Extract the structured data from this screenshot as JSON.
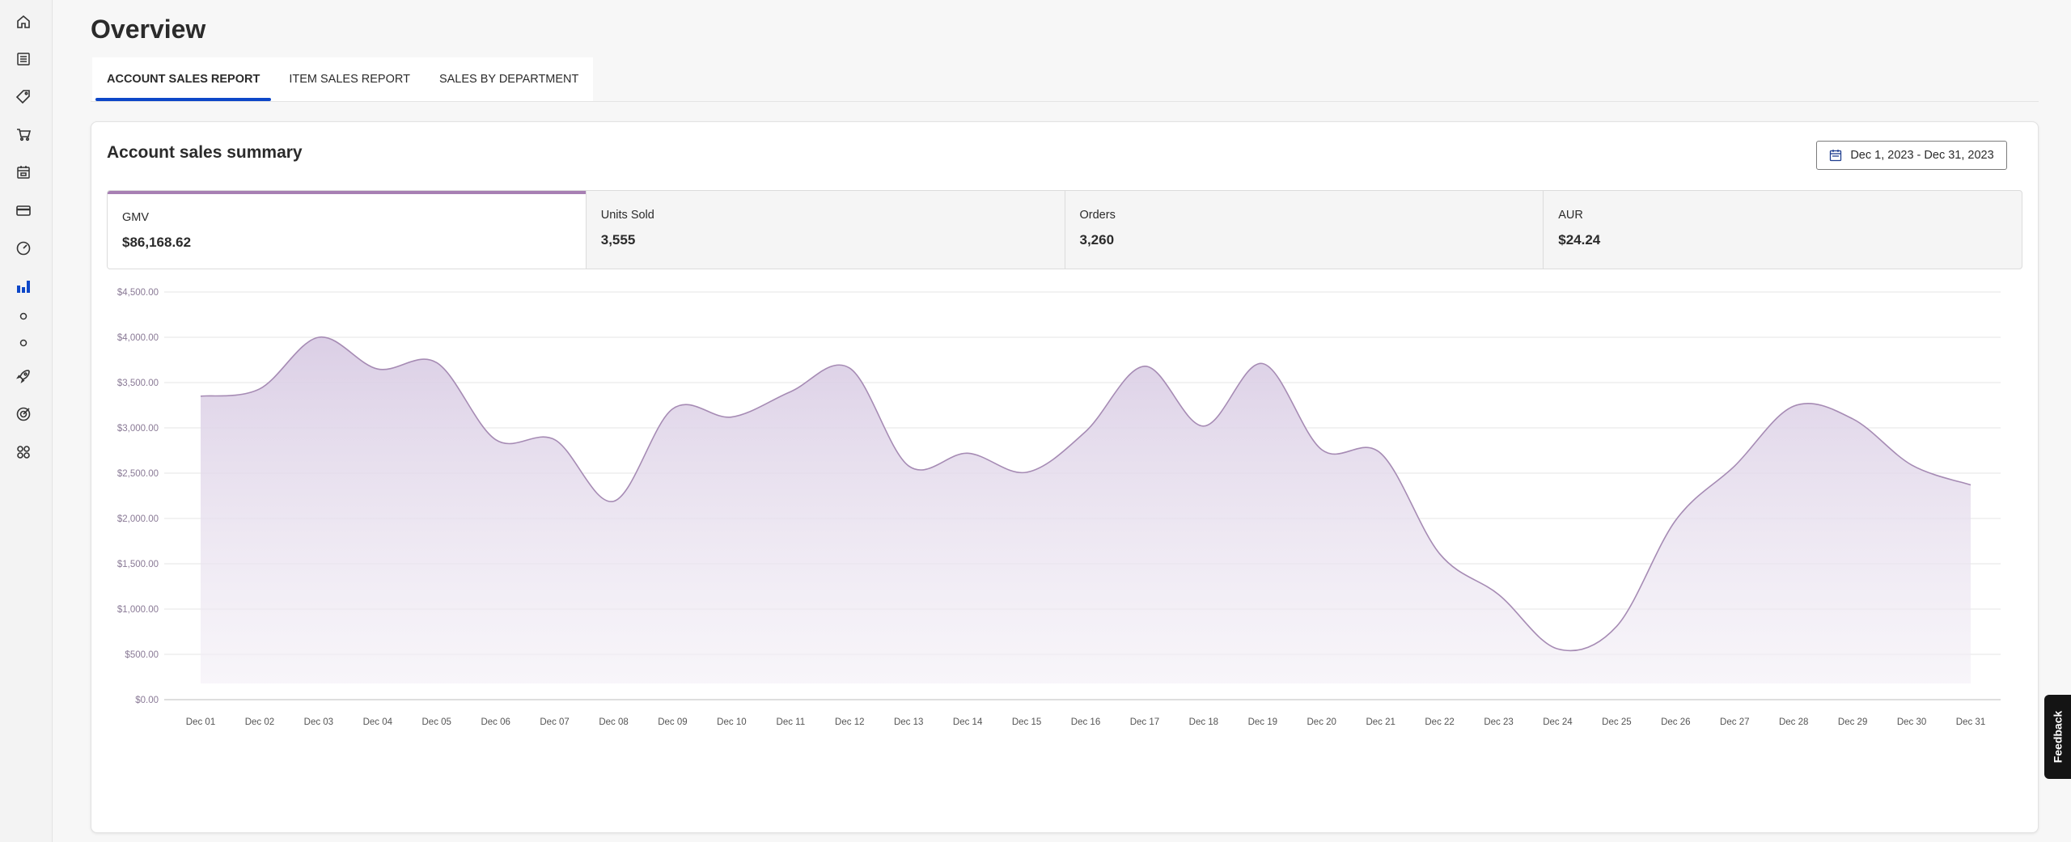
{
  "page": {
    "title": "Overview"
  },
  "sidebar": {
    "items": [
      {
        "name": "home-icon",
        "active": false
      },
      {
        "name": "list-icon",
        "active": false
      },
      {
        "name": "tag-icon",
        "active": false
      },
      {
        "name": "cart-icon",
        "active": false
      },
      {
        "name": "calendar-box-icon",
        "active": false
      },
      {
        "name": "card-icon",
        "active": false
      },
      {
        "name": "speedometer-icon",
        "active": false
      },
      {
        "name": "bar-chart-icon",
        "active": true
      },
      {
        "name": "small-circle-icon",
        "active": false
      },
      {
        "name": "small-circle-icon",
        "active": false
      },
      {
        "name": "rocket-icon",
        "active": false
      },
      {
        "name": "target-icon",
        "active": false
      },
      {
        "name": "grid-icon",
        "active": false
      }
    ]
  },
  "tabs": [
    {
      "label": "ACCOUNT SALES REPORT",
      "active": true
    },
    {
      "label": "ITEM SALES REPORT",
      "active": false
    },
    {
      "label": "SALES BY DEPARTMENT",
      "active": false
    }
  ],
  "card": {
    "title": "Account sales summary",
    "date_range": "Dec 1, 2023 - Dec 31, 2023"
  },
  "metrics": [
    {
      "label": "GMV",
      "value": "$86,168.62",
      "active": true
    },
    {
      "label": "Units Sold",
      "value": "3,555",
      "active": false
    },
    {
      "label": "Orders",
      "value": "3,260",
      "active": false
    },
    {
      "label": "AUR",
      "value": "$24.24",
      "active": false
    }
  ],
  "feedback": {
    "label": "Feedback"
  },
  "colors": {
    "accent": "#0d47c8",
    "series_line": "#a68bb4",
    "series_fill": "#dcd0e6",
    "metric_highlight": "#a77fb3"
  },
  "chart_data": {
    "type": "area",
    "title": "",
    "xlabel": "",
    "ylabel": "",
    "ylim": [
      0,
      4500
    ],
    "grid": true,
    "yticks": [
      "$0.00",
      "$500.00",
      "$1,000.00",
      "$1,500.00",
      "$2,000.00",
      "$2,500.00",
      "$3,000.00",
      "$3,500.00",
      "$4,000.00",
      "$4,500.00"
    ],
    "categories": [
      "Dec 01",
      "Dec 02",
      "Dec 03",
      "Dec 04",
      "Dec 05",
      "Dec 06",
      "Dec 07",
      "Dec 08",
      "Dec 09",
      "Dec 10",
      "Dec 11",
      "Dec 12",
      "Dec 13",
      "Dec 14",
      "Dec 15",
      "Dec 16",
      "Dec 17",
      "Dec 18",
      "Dec 19",
      "Dec 20",
      "Dec 21",
      "Dec 22",
      "Dec 23",
      "Dec 24",
      "Dec 25",
      "Dec 26",
      "Dec 27",
      "Dec 28",
      "Dec 29",
      "Dec 30",
      "Dec 31"
    ],
    "series": [
      {
        "values": [
          3350,
          3430,
          4000,
          3650,
          3720,
          2870,
          2870,
          2190,
          3210,
          3120,
          3400,
          3660,
          2580,
          2720,
          2510,
          2960,
          3680,
          3020,
          3710,
          2760,
          2720,
          1610,
          1160,
          560,
          810,
          1980,
          2580,
          3240,
          3100,
          2590,
          2370
        ]
      }
    ]
  }
}
